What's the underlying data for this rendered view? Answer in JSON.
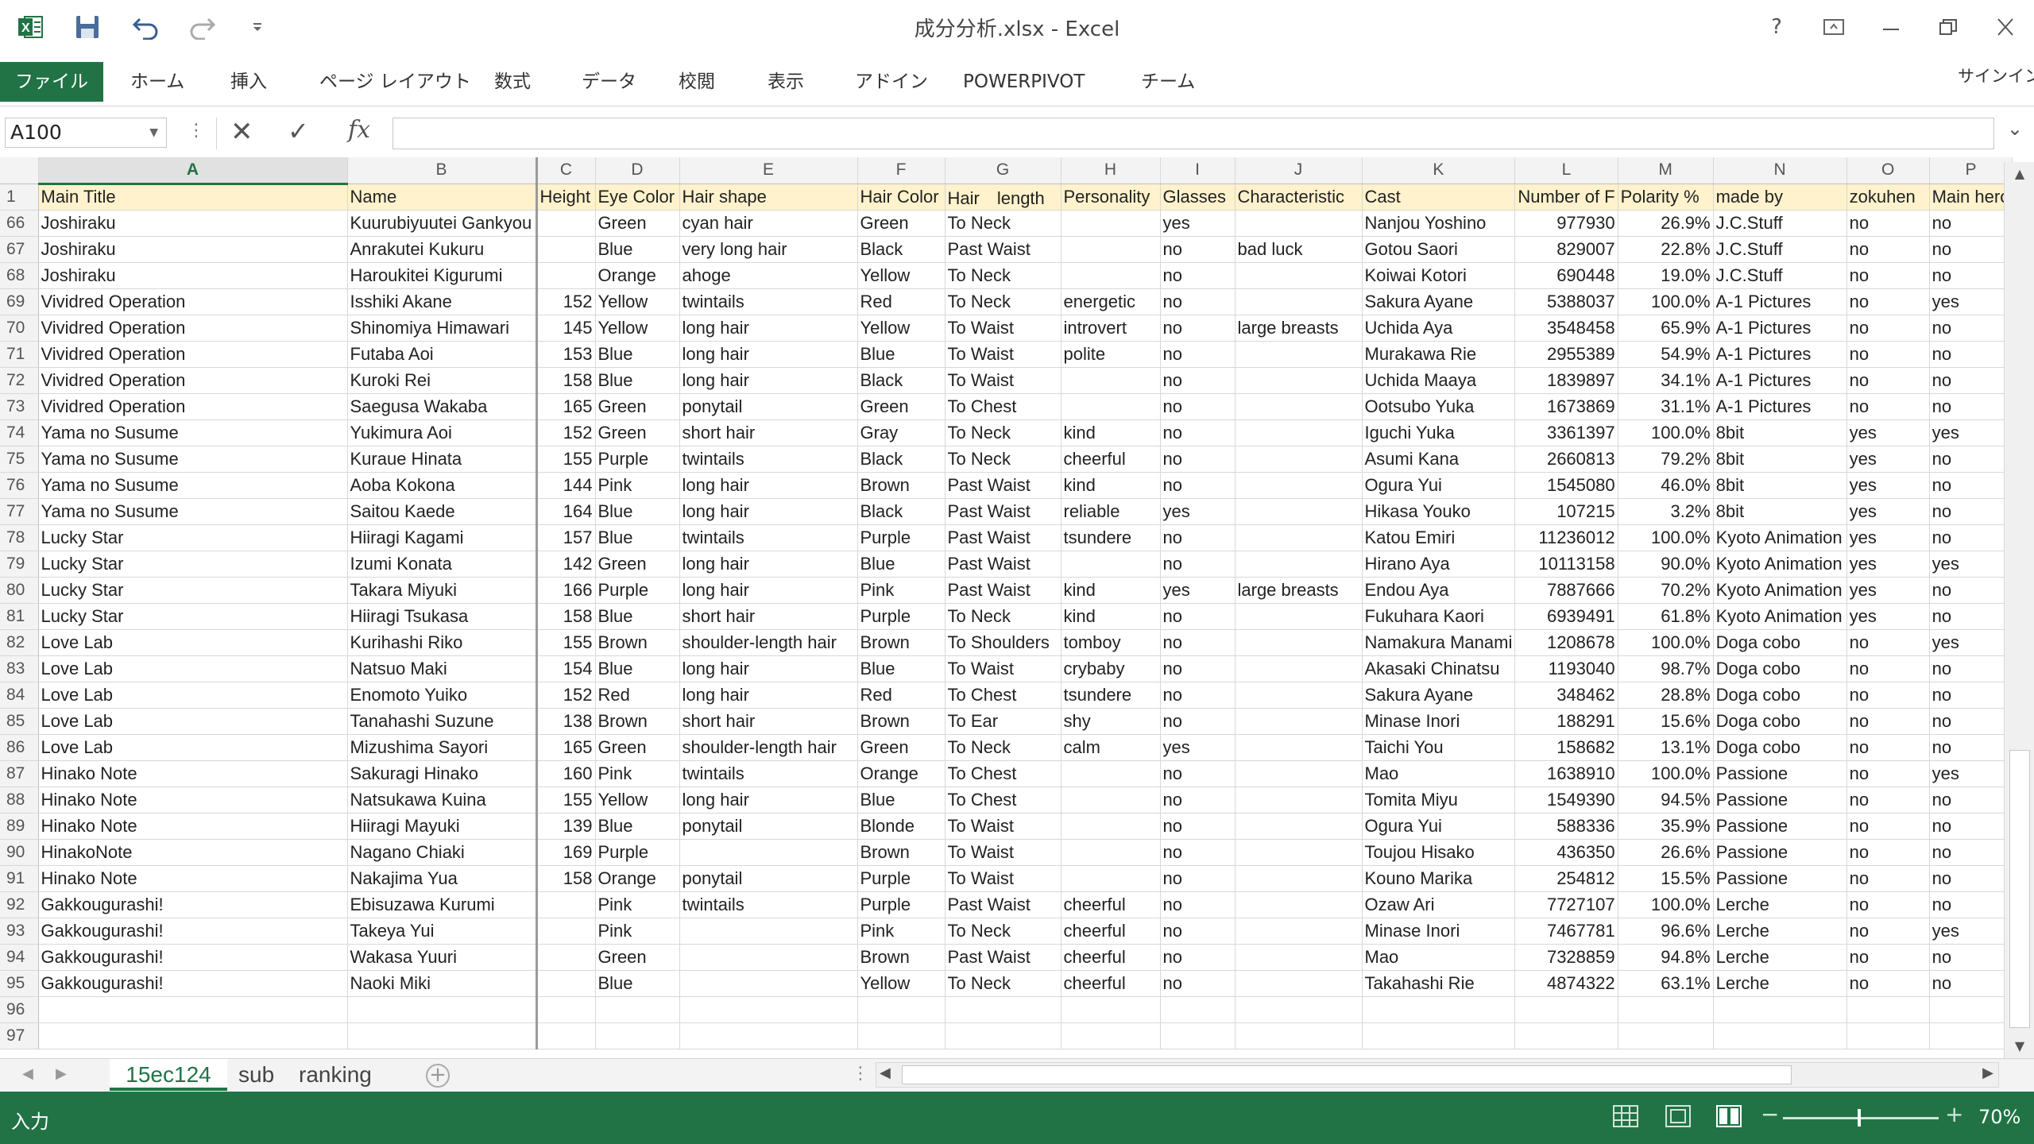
{
  "titlebar": {
    "title": "成分分析.xlsx - Excel",
    "help": "?",
    "icons": [
      "excel-logo-icon",
      "save-icon",
      "undo-icon",
      "redo-icon",
      "customize-qat-icon",
      "help-icon",
      "ribbon-display-icon",
      "minimize-icon",
      "restore-icon",
      "close-icon"
    ]
  },
  "ribbon": {
    "tabs": [
      "ファイル",
      "ホーム",
      "挿入",
      "ページ レイアウト",
      "数式",
      "データ",
      "校閲",
      "表示",
      "アドイン",
      "POWERPIVOT",
      "チーム"
    ],
    "signin": "サインイン"
  },
  "formula_bar": {
    "name_box": "A100",
    "value": ""
  },
  "sheet": {
    "columns": [
      "A",
      "B",
      "C",
      "D",
      "E",
      "F",
      "G",
      "H",
      "I",
      "J",
      "K",
      "L",
      "M",
      "N",
      "O",
      "P"
    ],
    "selected_column": "A",
    "header_row_number": "1",
    "header": [
      "Main Title",
      "Name",
      "Height",
      "Eye Color",
      "Hair shape",
      "Hair Color",
      "Hair　length",
      "Personality",
      "Glasses",
      "Characteristic",
      "Cast",
      "Number of F",
      "Polarity %",
      "made by",
      "zokuhen",
      "Main hero"
    ],
    "rows": [
      [
        "66",
        "Joshiraku",
        "Kuurubiyuutei Gankyou",
        "",
        "Green",
        "cyan hair",
        "Green",
        "To Neck",
        "",
        "yes",
        "",
        "Nanjou Yoshino",
        "977930",
        "26.9%",
        "J.C.Stuff",
        "no",
        "no"
      ],
      [
        "67",
        "Joshiraku",
        "Anrakutei Kukuru",
        "",
        "Blue",
        "very long hair",
        "Black",
        "Past Waist",
        "",
        "no",
        "bad luck",
        "Gotou Saori",
        "829007",
        "22.8%",
        "J.C.Stuff",
        "no",
        "no"
      ],
      [
        "68",
        "Joshiraku",
        "Haroukitei Kigurumi",
        "",
        "Orange",
        "ahoge",
        "Yellow",
        "To Neck",
        "",
        "no",
        "",
        "Koiwai Kotori",
        "690448",
        "19.0%",
        "J.C.Stuff",
        "no",
        "no"
      ],
      [
        "69",
        "Vividred Operation",
        "Isshiki Akane",
        "152",
        "Yellow",
        "twintails",
        "Red",
        "To Neck",
        "energetic",
        "no",
        "",
        "Sakura Ayane",
        "5388037",
        "100.0%",
        "A-1 Pictures",
        "no",
        "yes"
      ],
      [
        "70",
        "Vividred Operation",
        "Shinomiya Himawari",
        "145",
        "Yellow",
        "long hair",
        "Yellow",
        "To Waist",
        "introvert",
        "no",
        "large breasts",
        "Uchida Aya",
        "3548458",
        "65.9%",
        "A-1 Pictures",
        "no",
        "no"
      ],
      [
        "71",
        "Vividred Operation",
        "Futaba Aoi",
        "153",
        "Blue",
        "long hair",
        "Blue",
        "To Waist",
        "polite",
        "no",
        "",
        "Murakawa Rie",
        "2955389",
        "54.9%",
        "A-1 Pictures",
        "no",
        "no"
      ],
      [
        "72",
        "Vividred Operation",
        "Kuroki Rei",
        "158",
        "Blue",
        "long hair",
        "Black",
        "To Waist",
        "",
        "no",
        "",
        "Uchida Maaya",
        "1839897",
        "34.1%",
        "A-1 Pictures",
        "no",
        "no"
      ],
      [
        "73",
        "Vividred Operation",
        "Saegusa Wakaba",
        "165",
        "Green",
        "ponytail",
        "Green",
        "To Chest",
        "",
        "no",
        "",
        "Ootsubo Yuka",
        "1673869",
        "31.1%",
        "A-1 Pictures",
        "no",
        "no"
      ],
      [
        "74",
        "Yama no Susume",
        "Yukimura Aoi",
        "152",
        "Green",
        "short hair",
        "Gray",
        "To Neck",
        "kind",
        "no",
        "",
        "Iguchi Yuka",
        "3361397",
        "100.0%",
        "8bit",
        "yes",
        "yes"
      ],
      [
        "75",
        "Yama no Susume",
        "Kuraue Hinata",
        "155",
        "Purple",
        "twintails",
        "Black",
        "To Neck",
        "cheerful",
        "no",
        "",
        "Asumi Kana",
        "2660813",
        "79.2%",
        "8bit",
        "yes",
        "no"
      ],
      [
        "76",
        "Yama no Susume",
        "Aoba Kokona",
        "144",
        "Pink",
        "long hair",
        "Brown",
        "Past Waist",
        "kind",
        "no",
        "",
        "Ogura Yui",
        "1545080",
        "46.0%",
        "8bit",
        "yes",
        "no"
      ],
      [
        "77",
        "Yama no Susume",
        "Saitou Kaede",
        "164",
        "Blue",
        "long hair",
        "Black",
        "Past Waist",
        "reliable",
        "yes",
        "",
        "Hikasa Youko",
        "107215",
        "3.2%",
        "8bit",
        "yes",
        "no"
      ],
      [
        "78",
        "Lucky Star",
        "Hiiragi Kagami",
        "157",
        "Blue",
        "twintails",
        "Purple",
        "Past Waist",
        "tsundere",
        "no",
        "",
        "Katou Emiri",
        "11236012",
        "100.0%",
        "Kyoto Animation",
        "yes",
        "no"
      ],
      [
        "79",
        "Lucky Star",
        "Izumi Konata",
        "142",
        "Green",
        "long hair",
        "Blue",
        "Past Waist",
        "",
        "no",
        "",
        "Hirano Aya",
        "10113158",
        "90.0%",
        "Kyoto Animation",
        "yes",
        "yes"
      ],
      [
        "80",
        "Lucky Star",
        "Takara Miyuki",
        "166",
        "Purple",
        "long hair",
        "Pink",
        "Past Waist",
        "kind",
        "yes",
        "large breasts",
        "Endou Aya",
        "7887666",
        "70.2%",
        "Kyoto Animation",
        "yes",
        "no"
      ],
      [
        "81",
        "Lucky Star",
        "Hiiragi Tsukasa",
        "158",
        "Blue",
        "short hair",
        "Purple",
        "To Neck",
        "kind",
        "no",
        "",
        "Fukuhara Kaori",
        "6939491",
        "61.8%",
        "Kyoto Animation",
        "yes",
        "no"
      ],
      [
        "82",
        "Love Lab",
        "Kurihashi Riko",
        "155",
        "Brown",
        "shoulder-length hair",
        "Brown",
        "To Shoulders",
        "tomboy",
        "no",
        "",
        "Namakura Manami",
        "1208678",
        "100.0%",
        "Doga cobo",
        "no",
        "yes"
      ],
      [
        "83",
        "Love Lab",
        "Natsuo Maki",
        "154",
        "Blue",
        "long hair",
        "Blue",
        "To Waist",
        "crybaby",
        "no",
        "",
        "Akasaki Chinatsu",
        "1193040",
        "98.7%",
        "Doga cobo",
        "no",
        "no"
      ],
      [
        "84",
        "Love Lab",
        "Enomoto Yuiko",
        "152",
        "Red",
        "long hair",
        "Red",
        "To Chest",
        "tsundere",
        "no",
        "",
        "Sakura Ayane",
        "348462",
        "28.8%",
        "Doga cobo",
        "no",
        "no"
      ],
      [
        "85",
        "Love Lab",
        "Tanahashi Suzune",
        "138",
        "Brown",
        "short hair",
        "Brown",
        "To Ear",
        "shy",
        "no",
        "",
        "Minase Inori",
        "188291",
        "15.6%",
        "Doga cobo",
        "no",
        "no"
      ],
      [
        "86",
        "Love Lab",
        "Mizushima Sayori",
        "165",
        "Green",
        "shoulder-length hair",
        "Green",
        "To Neck",
        "calm",
        "yes",
        "",
        "Taichi You",
        "158682",
        "13.1%",
        "Doga cobo",
        "no",
        "no"
      ],
      [
        "87",
        "Hinako Note",
        "Sakuragi Hinako",
        "160",
        "Pink",
        "twintails",
        "Orange",
        "To Chest",
        "",
        "no",
        "",
        "Mao",
        "1638910",
        "100.0%",
        "Passione",
        "no",
        "yes"
      ],
      [
        "88",
        "Hinako Note",
        "Natsukawa Kuina",
        "155",
        "Yellow",
        "long hair",
        "Blue",
        "To Chest",
        "",
        "no",
        "",
        "Tomita Miyu",
        "1549390",
        "94.5%",
        "Passione",
        "no",
        "no"
      ],
      [
        "89",
        "Hinako Note",
        "Hiiragi Mayuki",
        "139",
        "Blue",
        "ponytail",
        "Blonde",
        "To Waist",
        "",
        "no",
        "",
        "Ogura Yui",
        "588336",
        "35.9%",
        "Passione",
        "no",
        "no"
      ],
      [
        "90",
        "HinakoNote",
        "Nagano Chiaki",
        "169",
        "Purple",
        "",
        "Brown",
        "To Waist",
        "",
        "no",
        "",
        "Toujou Hisako",
        "436350",
        "26.6%",
        "Passione",
        "no",
        "no"
      ],
      [
        "91",
        "Hinako Note",
        "Nakajima Yua",
        "158",
        "Orange",
        "ponytail",
        "Purple",
        "To Waist",
        "",
        "no",
        "",
        "Kouno Marika",
        "254812",
        "15.5%",
        "Passione",
        "no",
        "no"
      ],
      [
        "92",
        "Gakkougurashi!",
        "Ebisuzawa Kurumi",
        "",
        "Pink",
        "twintails",
        "Purple",
        "Past Waist",
        "cheerful",
        "no",
        "",
        "Ozaw Ari",
        "7727107",
        "100.0%",
        "Lerche",
        "no",
        "no"
      ],
      [
        "93",
        "Gakkougurashi!",
        "Takeya Yui",
        "",
        "Pink",
        "",
        "Pink",
        "To Neck",
        "cheerful",
        "no",
        "",
        "Minase Inori",
        "7467781",
        "96.6%",
        "Lerche",
        "no",
        "yes"
      ],
      [
        "94",
        "Gakkougurashi!",
        "Wakasa Yuuri",
        "",
        "Green",
        "",
        "Brown",
        "Past Waist",
        "cheerful",
        "no",
        "",
        "Mao",
        "7328859",
        "94.8%",
        "Lerche",
        "no",
        "no"
      ],
      [
        "95",
        "Gakkougurashi!",
        "Naoki Miki",
        "",
        "Blue",
        "",
        "Yellow",
        "To Neck",
        "cheerful",
        "no",
        "",
        "Takahashi Rie",
        "4874322",
        "63.1%",
        "Lerche",
        "no",
        "no"
      ],
      [
        "96",
        "",
        "",
        "",
        "",
        "",
        "",
        "",
        "",
        "",
        "",
        "",
        "",
        "",
        "",
        "",
        ""
      ],
      [
        "97",
        "",
        "",
        "",
        "",
        "",
        "",
        "",
        "",
        "",
        "",
        "",
        "",
        "",
        "",
        "",
        ""
      ]
    ]
  },
  "sheet_tabs": [
    "15ec124",
    "sub",
    "ranking"
  ],
  "status": {
    "mode": "入力",
    "zoom": "70%"
  },
  "colors": {
    "excel_green": "#217346",
    "header_fill": "#fff2cc"
  }
}
